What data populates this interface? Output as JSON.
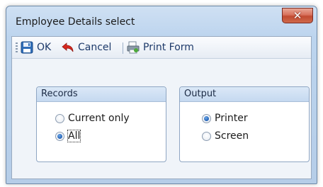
{
  "window": {
    "title": "Employee Details select",
    "close_glyph": "✕"
  },
  "toolbar": {
    "ok_label": "OK",
    "cancel_label": "Cancel",
    "print_label": "Print Form"
  },
  "records": {
    "title": "Records",
    "options": [
      {
        "label": "Current only",
        "checked": false
      },
      {
        "label": "All",
        "checked": true
      }
    ]
  },
  "output": {
    "title": "Output",
    "options": [
      {
        "label": "Printer",
        "checked": true
      },
      {
        "label": "Screen",
        "checked": false
      }
    ]
  },
  "colors": {
    "accent": "#1f5fb4",
    "close": "#c14a31"
  }
}
